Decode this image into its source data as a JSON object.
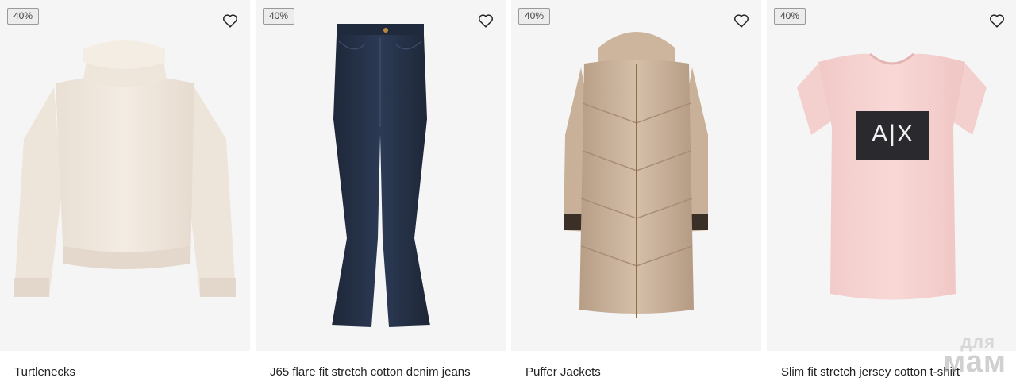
{
  "products": [
    {
      "badge": "40%",
      "title": "Turtlenecks",
      "image": "cream knit turtleneck sweater"
    },
    {
      "badge": "40%",
      "title": "J65 flare fit stretch cotton denim jeans",
      "image": "dark blue flare denim jeans"
    },
    {
      "badge": "40%",
      "title": "Puffer Jackets",
      "image": "beige long hooded puffer coat"
    },
    {
      "badge": "40%",
      "title": "Slim fit stretch jersey cotton t-shirt",
      "image": "pink t-shirt with A|X logo"
    }
  ],
  "tshirt_logo": "A|X",
  "icons": {
    "wishlist": "heart-outline-icon"
  },
  "watermark": {
    "top": "для",
    "bottom": "мам"
  },
  "colors": {
    "image_bg": "#f5f5f5",
    "badge_bg": "#ececec",
    "text": "#222222"
  }
}
